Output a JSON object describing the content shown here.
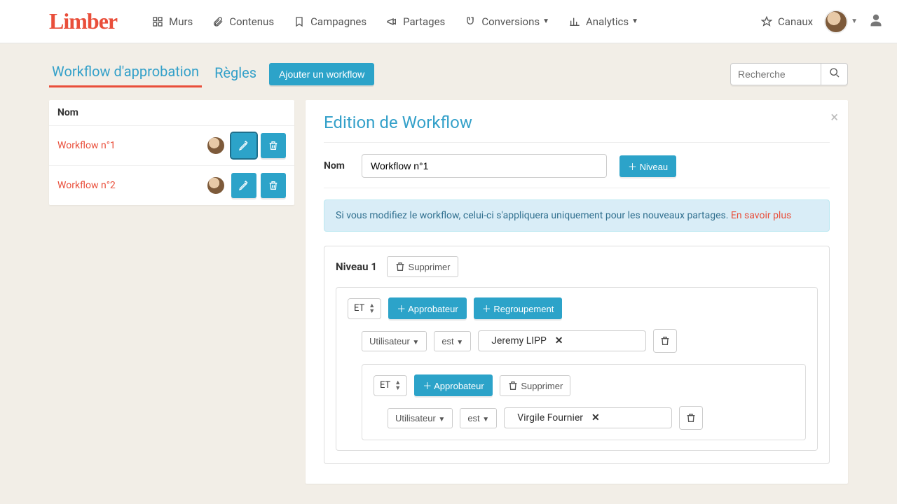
{
  "brand": "Limber",
  "nav": {
    "murs": "Murs",
    "contenus": "Contenus",
    "campagnes": "Campagnes",
    "partages": "Partages",
    "conversions": "Conversions",
    "analytics": "Analytics",
    "canaux": "Canaux"
  },
  "tabs": {
    "workflow": "Workflow d'approbation",
    "regles": "Règles"
  },
  "buttons": {
    "add_workflow": "Ajouter un workflow",
    "niveau": "Niveau",
    "approbateur": "Approbateur",
    "regroupement": "Regroupement",
    "supprimer": "Supprimer"
  },
  "search": {
    "placeholder": "Recherche"
  },
  "list": {
    "header": "Nom",
    "items": [
      {
        "name": "Workflow n°1"
      },
      {
        "name": "Workflow n°2"
      }
    ]
  },
  "edit": {
    "title": "Edition de Workflow",
    "name_label": "Nom",
    "name_value": "Workflow n°1",
    "info_text": "Si vous modifiez le workflow, celui-ci s'appliquera uniquement pour les nouveaux partages. ",
    "info_link": "En savoir plus",
    "level_label": "Niveau 1",
    "logic": "ET",
    "field_user": "Utilisateur",
    "op_est": "est",
    "approver1": "Jeremy LIPP",
    "approver2": "Virgile Fournier"
  }
}
